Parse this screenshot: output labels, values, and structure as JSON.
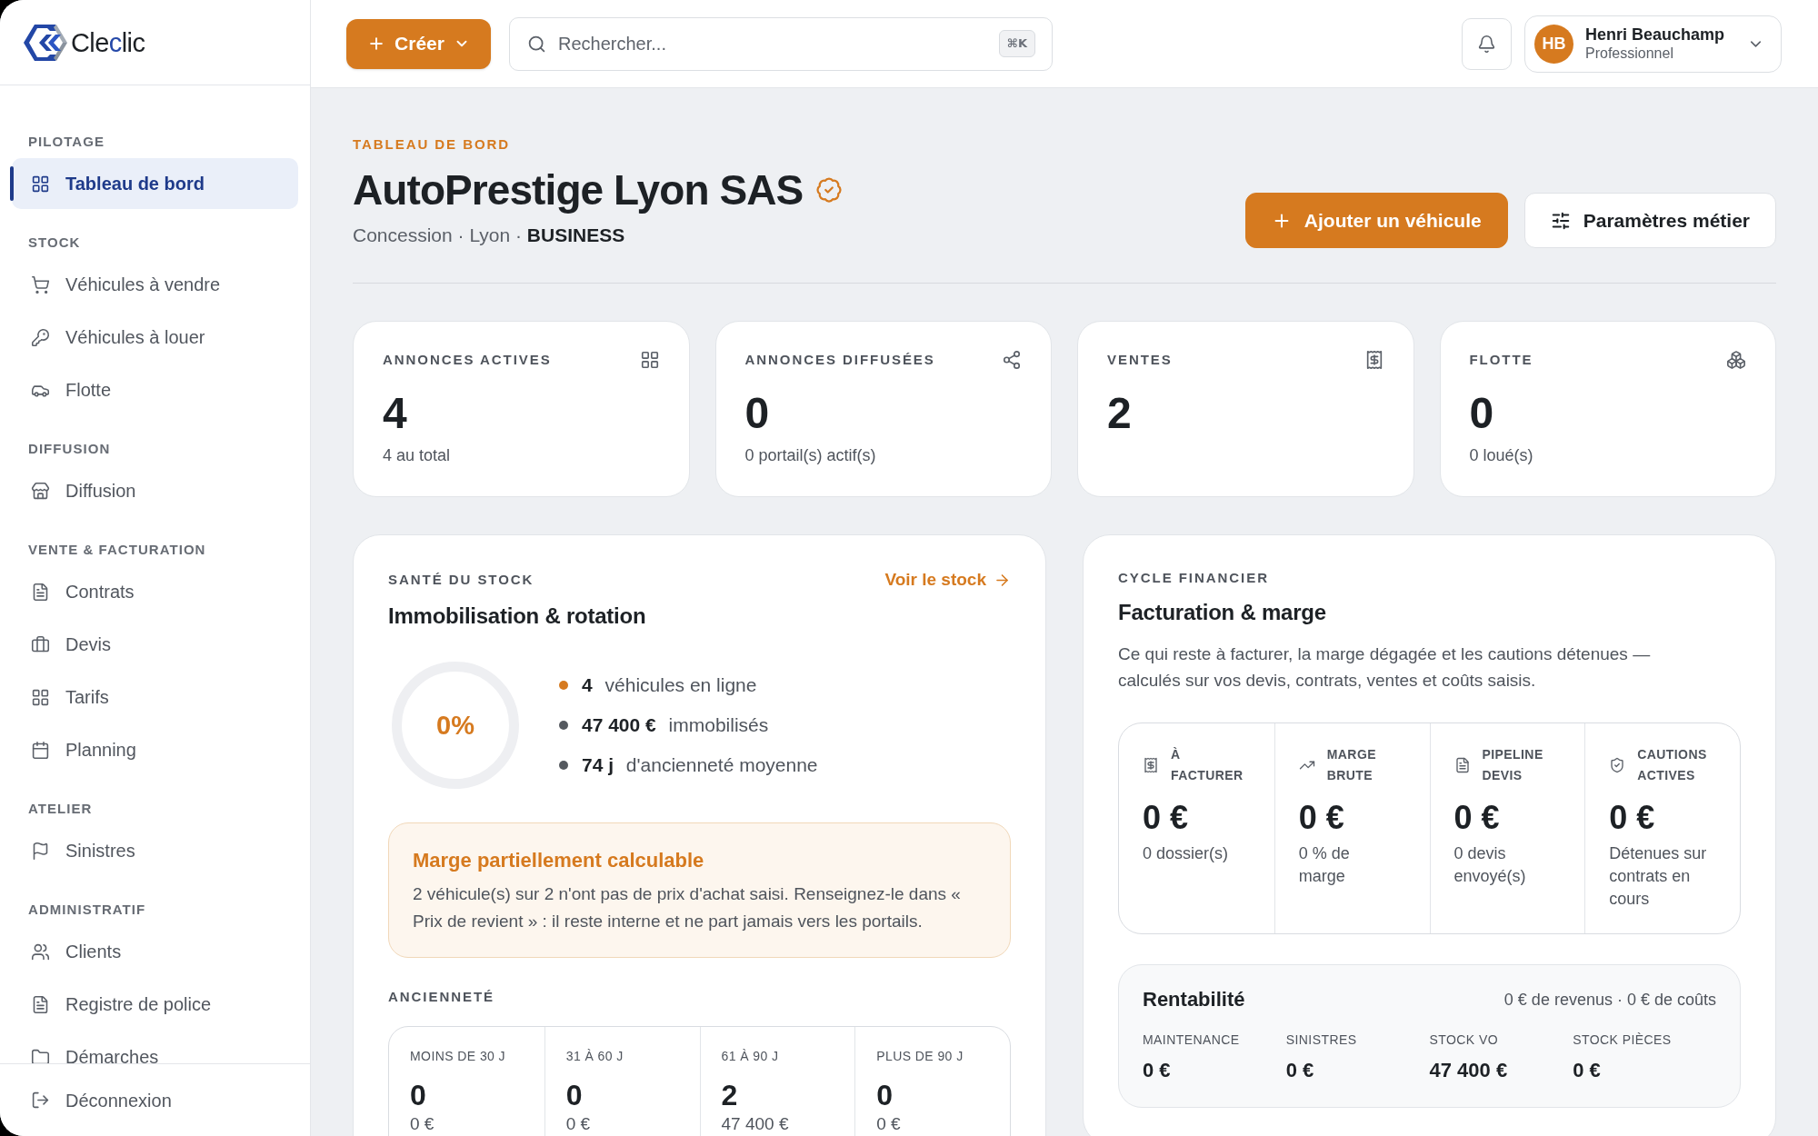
{
  "brand": {
    "name_parts": [
      {
        "text": "Cle",
        "accent": false
      },
      {
        "text": "c",
        "accent": true
      },
      {
        "text": "lic",
        "accent": false
      }
    ]
  },
  "sidebar": {
    "sections": [
      {
        "title": "PILOTAGE",
        "items": [
          {
            "label": "Tableau de bord",
            "selected": true
          }
        ]
      },
      {
        "title": "STOCK",
        "items": [
          {
            "label": "Véhicules à vendre",
            "selected": false
          },
          {
            "label": "Véhicules à louer",
            "selected": false
          },
          {
            "label": "Flotte",
            "selected": false
          }
        ]
      },
      {
        "title": "DIFFUSION",
        "items": [
          {
            "label": "Diffusion",
            "selected": false
          }
        ]
      },
      {
        "title": "VENTE & FACTURATION",
        "items": [
          {
            "label": "Contrats",
            "selected": false
          },
          {
            "label": "Devis",
            "selected": false
          },
          {
            "label": "Tarifs",
            "selected": false
          },
          {
            "label": "Planning",
            "selected": false
          }
        ]
      },
      {
        "title": "ATELIER",
        "items": [
          {
            "label": "Sinistres",
            "selected": false
          }
        ]
      },
      {
        "title": "ADMINISTRATIF",
        "items": [
          {
            "label": "Clients",
            "selected": false
          },
          {
            "label": "Registre de police",
            "selected": false
          },
          {
            "label": "Démarches",
            "selected": false
          }
        ]
      }
    ],
    "logout": "Déconnexion"
  },
  "topbar": {
    "create_button": "Créer",
    "search": {
      "placeholder": "Rechercher...",
      "shortcut": "⌘K"
    },
    "user": {
      "initials": "HB",
      "name": "Henri Beauchamp",
      "role": "Professionnel"
    }
  },
  "page_header": {
    "eyebrow": "TABLEAU DE BORD",
    "title": "AutoPrestige Lyon SAS",
    "subtitle": "Concession · Lyon · **BUSINESS**",
    "actions": [
      {
        "label": "Ajouter un véhicule",
        "kind": "primary"
      },
      {
        "label": "Paramètres métier",
        "kind": "secondary"
      }
    ]
  },
  "stat_cards": [
    {
      "label": "ANNONCES ACTIVES",
      "value": "4",
      "note": "4 au total"
    },
    {
      "label": "ANNONCES DIFFUSÉES",
      "value": "0",
      "note": "0 portail(s) actif(s)"
    },
    {
      "label": "VENTES",
      "value": "2"
    },
    {
      "label": "FLOTTE",
      "value": "0",
      "note": "0 loué(s)"
    }
  ],
  "stock_health": {
    "eyebrow": "SANTÉ DU STOCK",
    "title": "Immobilisation & rotation",
    "link": "Voir le stock",
    "gauge": {
      "reading": "0%"
    },
    "bullets": [
      {
        "text": "**4** véhicules en ligne",
        "color": "#d67a1f"
      },
      {
        "text": "**47 400 €** immobilisés",
        "color": "#55595f"
      },
      {
        "text": "**74 j** d'ancienneté moyenne",
        "color": "#55595f"
      }
    ],
    "alert": {
      "title": "Marge partiellement calculable",
      "text": "2 véhicule(s) sur 2 n'ont pas de prix d'achat saisi. Renseignez-le dans « Prix de revient » : il reste interne et ne part jamais vers les portails."
    },
    "aging": {
      "title": "ANCIENNETÉ",
      "buckets": [
        {
          "label": "MOINS DE 30 J",
          "count": "0",
          "amount": "0 €"
        },
        {
          "label": "31 À 60 J",
          "count": "0",
          "amount": "0 €"
        },
        {
          "label": "61 À 90 J",
          "count": "2",
          "amount": "47 400 €"
        },
        {
          "label": "PLUS DE 90 J",
          "count": "0",
          "amount": "0 €"
        }
      ]
    }
  },
  "financial_cycle": {
    "eyebrow": "CYCLE FINANCIER",
    "title": "Facturation & marge",
    "description": "Ce qui reste à facturer, la marge dégagée et les cautions détenues — calculés sur vos devis, contrats, ventes et coûts saisis.",
    "metrics": [
      {
        "label": "À FACTURER",
        "value": "0 €",
        "note": "0 dossier(s)"
      },
      {
        "label": "MARGE BRUTE",
        "value": "0 €",
        "note": "0 % de marge"
      },
      {
        "label": "PIPELINE DEVIS",
        "value": "0 €",
        "note": "0 devis envoyé(s)"
      },
      {
        "label": "CAUTIONS ACTIVES",
        "value": "0 €",
        "note": "Détenues sur contrats en cours"
      }
    ],
    "profitability": {
      "title": "Rentabilité",
      "summary": "0 € de revenus · 0 € de coûts",
      "items": [
        {
          "label": "MAINTENANCE",
          "value": "0 €"
        },
        {
          "label": "SINISTRES",
          "value": "0 €"
        },
        {
          "label": "STOCK VO",
          "value": "47 400 €"
        },
        {
          "label": "STOCK PIÈCES",
          "value": "0 €"
        }
      ]
    }
  }
}
